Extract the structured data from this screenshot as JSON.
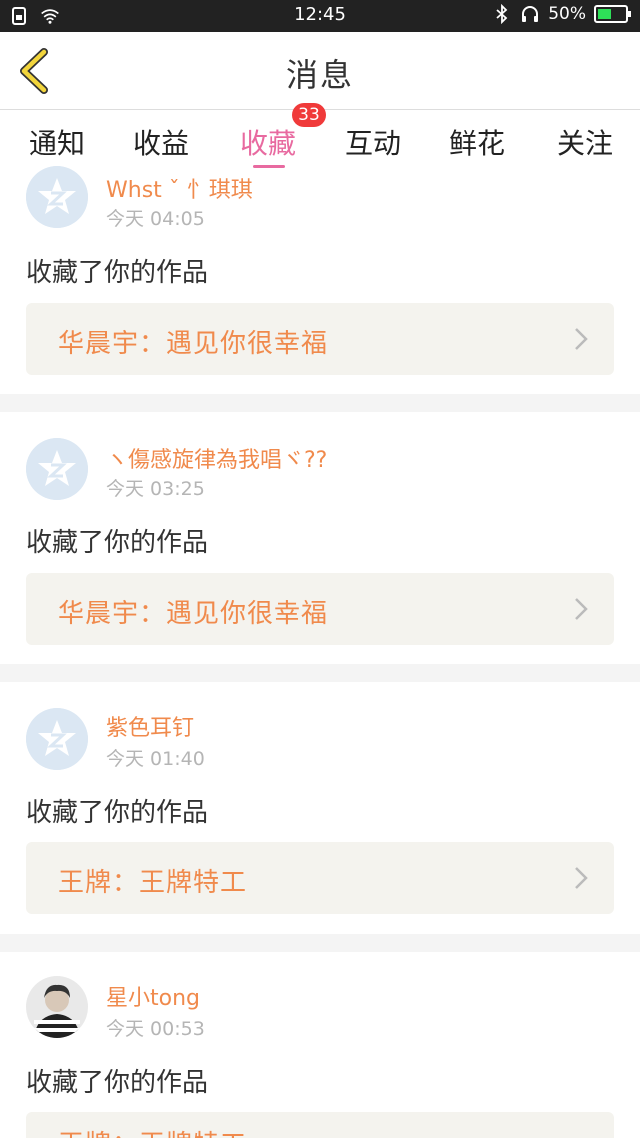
{
  "status_bar": {
    "time": "12:45",
    "battery": "50%",
    "battery_level": 0.5,
    "icons": [
      "sim-icon",
      "wifi-icon",
      "bluetooth-icon",
      "headphones-icon",
      "battery-icon"
    ]
  },
  "header": {
    "title": "消息",
    "back_icon": "chevron-left-icon"
  },
  "tabs": [
    {
      "label": "通知"
    },
    {
      "label": "收益"
    },
    {
      "label": "收藏",
      "active": true,
      "badge": "33"
    },
    {
      "label": "互动"
    },
    {
      "label": "鲜花"
    },
    {
      "label": "关注"
    }
  ],
  "colors": {
    "accent": "#e86aa0",
    "name_orange": "#f08a4c",
    "badge_red": "#f03a3a",
    "back_yellow": "#f2d53c"
  },
  "messages": [
    {
      "username": "Whst ˇ 忄琪琪",
      "time": "今天 04:05",
      "action": "收藏了你的作品",
      "work": "华晨宇：遇见你很幸福",
      "avatar": "default-avatar-icon"
    },
    {
      "username": "ヽ傷感旋律為我唱ヾ??",
      "time": "今天 03:25",
      "action": "收藏了你的作品",
      "work": "华晨宇：遇见你很幸福",
      "avatar": "default-avatar-icon"
    },
    {
      "username": "紫色耳钉",
      "time": "今天 01:40",
      "action": "收藏了你的作品",
      "work": "王牌：王牌特工",
      "avatar": "default-avatar-icon"
    },
    {
      "username": "星小tong",
      "time": "今天 00:53",
      "action": "收藏了你的作品",
      "work": "王牌：王牌特工",
      "avatar": "user-photo-avatar"
    }
  ]
}
